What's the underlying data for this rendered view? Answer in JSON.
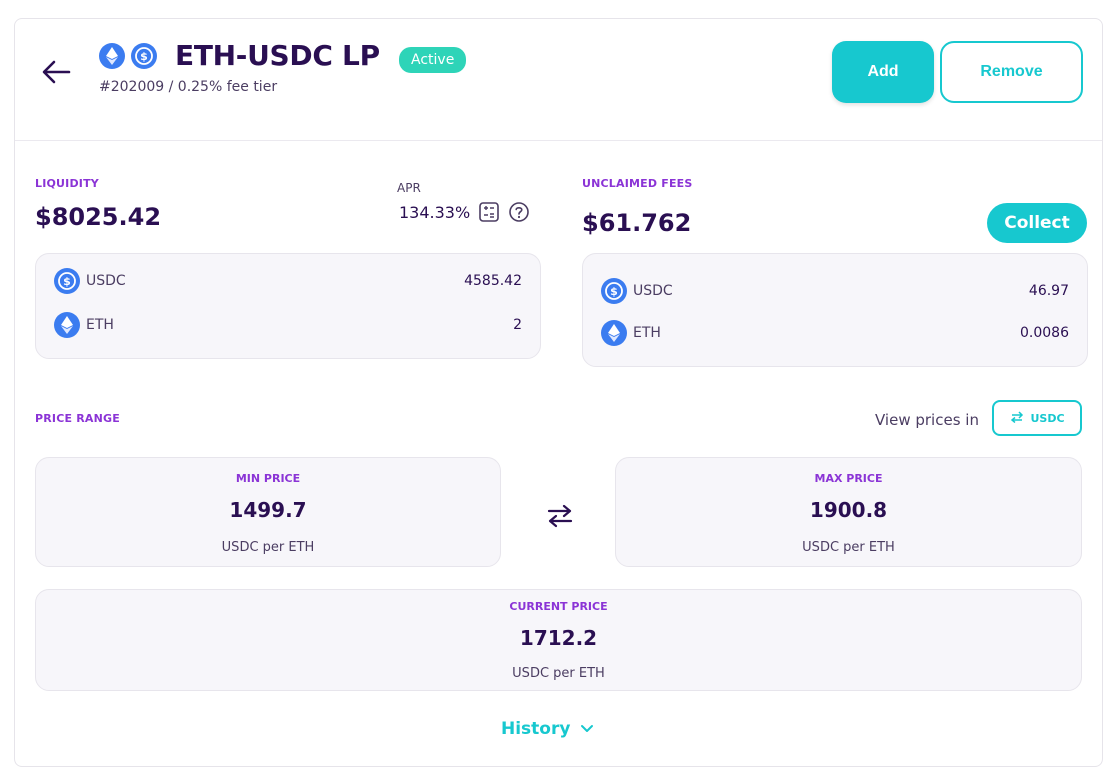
{
  "header": {
    "title": "ETH-USDC LP",
    "subtitle": "#202009 / 0.25% fee tier",
    "status_badge": "Active",
    "add_label": "Add",
    "remove_label": "Remove"
  },
  "liquidity": {
    "label": "LIQUIDITY",
    "value": "$8025.42",
    "apr_label": "APR",
    "apr_value": "134.33%",
    "tokens": [
      {
        "name": "USDC",
        "value": "4585.42",
        "icon": "usdc-icon"
      },
      {
        "name": "ETH",
        "value": "2",
        "icon": "eth-icon"
      }
    ]
  },
  "fees": {
    "label": "UNCLAIMED FEES",
    "value": "$61.762",
    "collect_label": "Collect",
    "tokens": [
      {
        "name": "USDC",
        "value": "46.97",
        "icon": "usdc-icon"
      },
      {
        "name": "ETH",
        "value": "0.0086",
        "icon": "eth-icon"
      }
    ]
  },
  "price_range": {
    "label": "PRICE RANGE",
    "view_prices_label": "View prices in",
    "toggle_label": "USDC",
    "min": {
      "label": "MIN PRICE",
      "value": "1499.7",
      "unit": "USDC per ETH"
    },
    "max": {
      "label": "MAX PRICE",
      "value": "1900.8",
      "unit": "USDC per ETH"
    },
    "current": {
      "label": "CURRENT PRICE",
      "value": "1712.2",
      "unit": "USDC per ETH"
    }
  },
  "history_label": "History",
  "colors": {
    "accent": "#17c8cf",
    "purple_label": "#8b34d6",
    "dark_text": "#2a0f52",
    "active_badge": "#2ed4b8",
    "coin_blue": "#3b7cf0"
  }
}
